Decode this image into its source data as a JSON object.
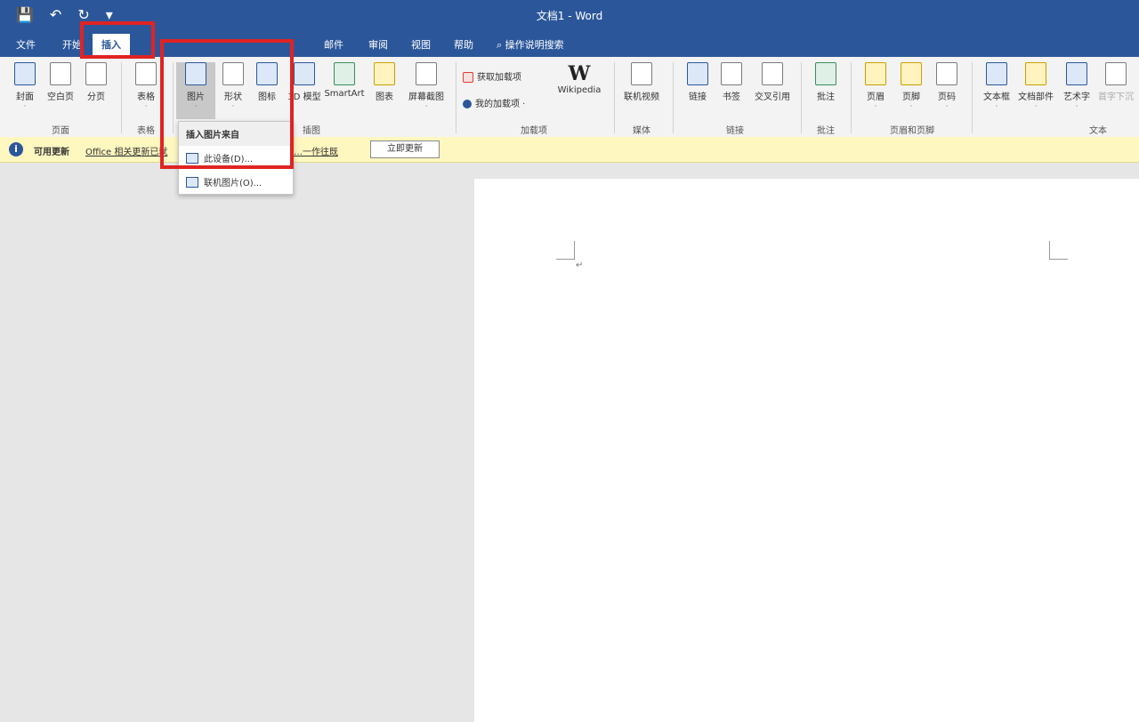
{
  "window": {
    "title": "文档1 - Word"
  },
  "qat": {
    "save_icon": "save-icon",
    "undo_icon": "undo-icon",
    "redo_icon": "redo-icon"
  },
  "tabs": {
    "file": "文件",
    "home": "开始",
    "insert": "插入",
    "mail": "邮件",
    "review": "审阅",
    "view": "视图",
    "help": "帮助",
    "tell": "操作说明搜索"
  },
  "ribbon": {
    "cover": "封面",
    "blank": "空白页",
    "break": "分页",
    "pages_group": "页面",
    "table": "表格",
    "tables_group": "表格",
    "pictures": "图片",
    "shapes": "形状",
    "icons": "图标",
    "models": "3D 模型",
    "smartart": "SmartArt",
    "chart": "图表",
    "screenshot": "屏幕截图",
    "illustrations_group": "插图",
    "get_addins": "获取加载项",
    "my_addins": "我的加载项",
    "wikipedia": "Wikipedia",
    "addins_group": "加载项",
    "online_video": "联机视频",
    "media_group": "媒体",
    "link": "链接",
    "bookmark": "书签",
    "cross_ref": "交叉引用",
    "links_group": "链接",
    "comment": "批注",
    "comments_group": "批注",
    "header": "页眉",
    "footer": "页脚",
    "page_number": "页码",
    "hf_group": "页眉和页脚",
    "textbox": "文本框",
    "quickparts": "文档部件",
    "wordart": "艺术字",
    "dropcap": "首字下沉",
    "text_group": "文本"
  },
  "notify": {
    "title": "可用更新",
    "msg_left": "Office 相关更新已就",
    "msg_right": "…一作往既",
    "update": "立即更新"
  },
  "dropdown": {
    "header": "插入图片来自",
    "this_device": "此设备(D)...",
    "online": "联机图片(O)..."
  }
}
